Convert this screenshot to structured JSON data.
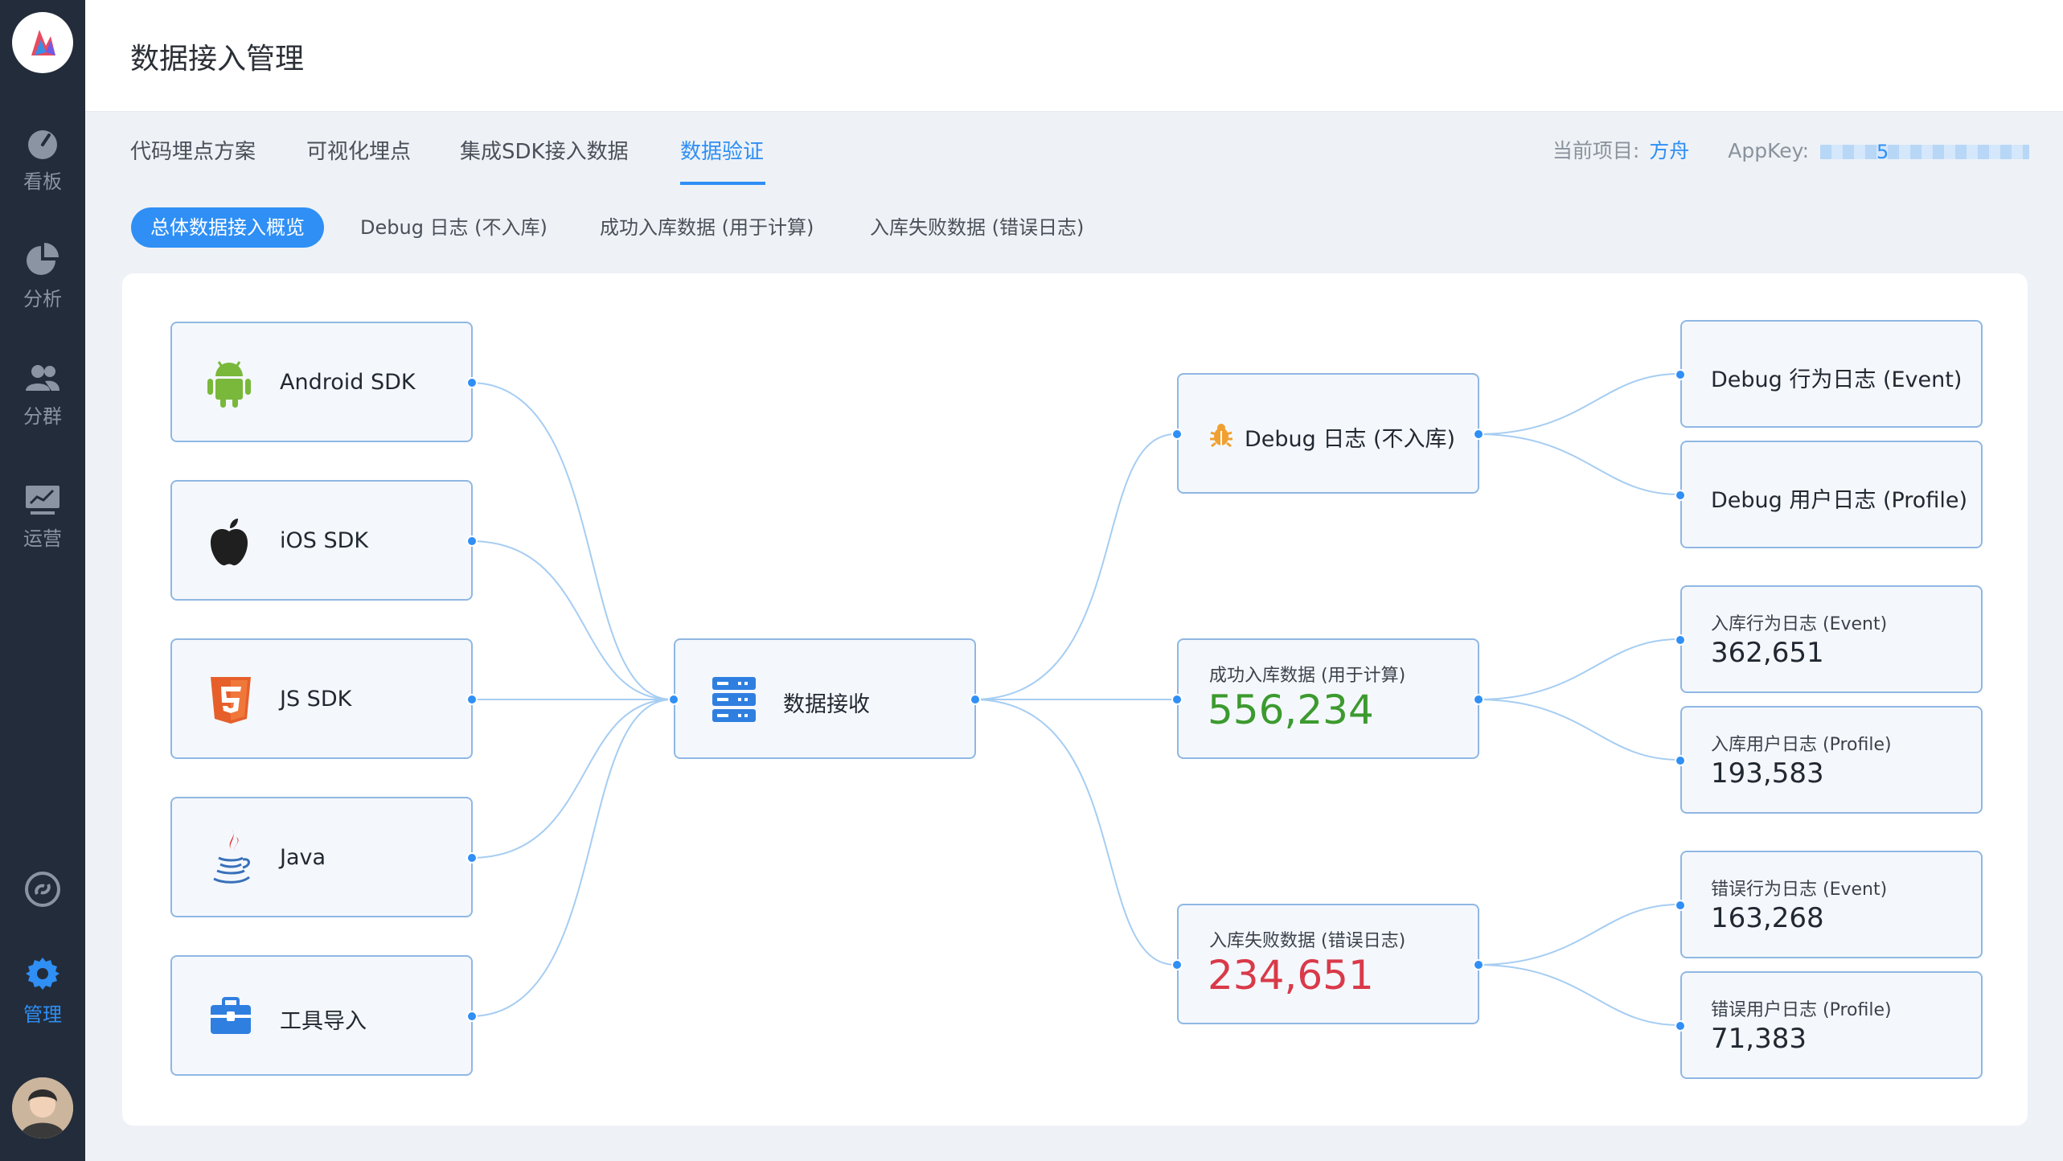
{
  "app": {
    "title": "数据接入管理"
  },
  "sidebar": {
    "items": [
      {
        "label": "看板",
        "icon": "gauge-icon"
      },
      {
        "label": "分析",
        "icon": "pie-chart-icon"
      },
      {
        "label": "分群",
        "icon": "users-icon"
      },
      {
        "label": "运营",
        "icon": "monitor-chart-icon"
      },
      {
        "label": "管理",
        "icon": "gear-icon"
      }
    ]
  },
  "top_tabs": [
    {
      "label": "代码埋点方案"
    },
    {
      "label": "可视化埋点"
    },
    {
      "label": "集成SDK接入数据"
    },
    {
      "label": "数据验证",
      "active": true
    }
  ],
  "project": {
    "label": "当前项目:",
    "name": "方舟",
    "appkey_label": "AppKey:",
    "appkey_visible": "5"
  },
  "sub_tabs": [
    {
      "label": "总体数据接入概览",
      "active": true
    },
    {
      "label": "Debug 日志 (不入库)"
    },
    {
      "label": "成功入库数据 (用于计算)"
    },
    {
      "label": "入库失败数据 (错误日志)"
    }
  ],
  "sources": [
    {
      "label": "Android SDK",
      "icon": "android-icon"
    },
    {
      "label": "iOS SDK",
      "icon": "apple-icon"
    },
    {
      "label": "JS SDK",
      "icon": "html5-icon"
    },
    {
      "label": "Java",
      "icon": "java-icon"
    },
    {
      "label": "工具导入",
      "icon": "toolbox-icon"
    }
  ],
  "center": {
    "label": "数据接收",
    "icon": "server-icon"
  },
  "outputs": {
    "debug": {
      "label": "Debug 日志 (不入库)",
      "icon": "bug-icon"
    },
    "success": {
      "label": "成功入库数据 (用于计算)",
      "value": "556,234",
      "color": "#3c9a2e"
    },
    "failure": {
      "label": "入库失败数据 (错误日志)",
      "value": "234,651",
      "color": "#d93a49"
    }
  },
  "details": {
    "debug_event": {
      "label": "Debug 行为日志 (Event)"
    },
    "debug_profile": {
      "label": "Debug 用户日志 (Profile)"
    },
    "ok_event": {
      "label": "入库行为日志 (Event)",
      "value": "362,651"
    },
    "ok_profile": {
      "label": "入库用户日志 (Profile)",
      "value": "193,583"
    },
    "err_event": {
      "label": "错误行为日志 (Event)",
      "value": "163,268"
    },
    "err_profile": {
      "label": "错误用户日志 (Profile)",
      "value": "71,383"
    }
  },
  "colors": {
    "accent": "#2f8ff5",
    "sidebar": "#232c3a",
    "node_border": "#90b7e3"
  }
}
